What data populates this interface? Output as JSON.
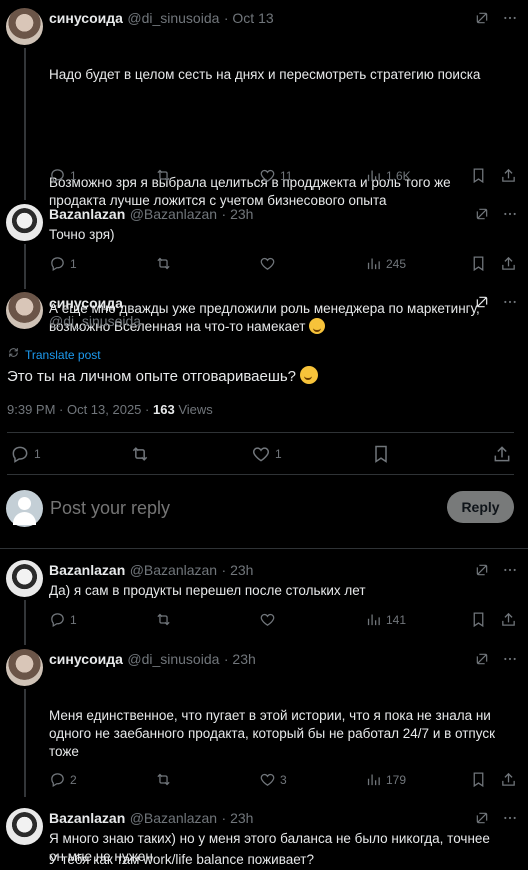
{
  "tweets": [
    {
      "name": "синусоида",
      "handle": "@di_sinusoida",
      "date": "· Oct 13",
      "para1": "Надо будет в целом сесть на днях и пересмотреть стратегию поиска",
      "para2": "Возможно зря я выбрала целиться в продджекта и роль того же продакта лучше ложится с учетом бизнесового опыта",
      "para3": "А еще мне дважды уже предложили роль менеджера по маркетингу, возможно Вселенная на что-то намекает",
      "replies": "1",
      "likes": "11",
      "views": "1.6K"
    },
    {
      "name": "Bazanlazan",
      "handle": "@Bazanlazan",
      "date": "· 23h",
      "text": "Точно зря)",
      "replies": "1",
      "views": "245"
    }
  ],
  "main_tweet": {
    "name": "синусоида",
    "handle": "@di_sinusoida",
    "translate": "Translate post",
    "text": "Это ты на личном опыте отговариваешь?",
    "time": "9:39 PM · Oct 13, 2025 ·",
    "views_count": "163",
    "views_label": "Views",
    "replies": "1",
    "likes": "1"
  },
  "composer": {
    "placeholder": "Post your reply",
    "button": "Reply"
  },
  "replies": [
    {
      "name": "Bazanlazan",
      "handle": "@Bazanlazan",
      "date": "· 23h",
      "text": "Да) я сам в продукты перешел после стольких лет",
      "replies": "1",
      "views": "141"
    },
    {
      "name": "синусоида",
      "handle": "@di_sinusoida",
      "date": "· 23h",
      "text": "Меня единственное, что пугает в этой истории, что я пока не знала ни одного не заебанного продакта, который бы не работал 24/7 и в отпуск тоже",
      "text2": "У тебя как там work/life balance поживает?",
      "replies": "2",
      "likes": "3",
      "views": "179"
    },
    {
      "name": "Bazanlazan",
      "handle": "@Bazanlazan",
      "date": "· 23h",
      "text": "Я много знаю таких) но у меня этого баланса не было никогда, точнее он мне не нужен"
    }
  ]
}
